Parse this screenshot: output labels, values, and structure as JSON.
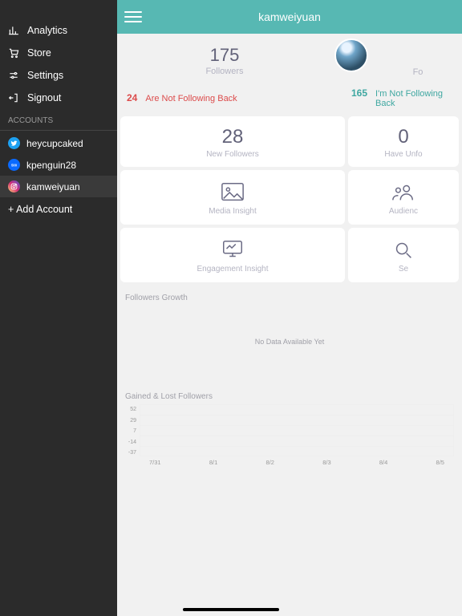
{
  "header": {
    "title": "kamweiyuan"
  },
  "sidebar": {
    "nav": [
      {
        "label": "Analytics"
      },
      {
        "label": "Store"
      },
      {
        "label": "Settings"
      },
      {
        "label": "Signout"
      }
    ],
    "section_label": "ACCOUNTS",
    "accounts": [
      {
        "label": "heycupcaked",
        "net": "twitter",
        "color": "#1DA1F2"
      },
      {
        "label": "kpenguin28",
        "net": "fivehundred",
        "color": "#0a6aff"
      },
      {
        "label": "kamweiyuan",
        "net": "instagram",
        "color": "#d63384"
      }
    ],
    "add_account": "+ Add Account"
  },
  "summary": {
    "followers_count": "175",
    "followers_label": "Followers",
    "following_label_partial": "Fo"
  },
  "warnings": {
    "left_count": "24",
    "left_label": "Are Not Following Back",
    "right_count": "165",
    "right_label": "I'm Not Following Back"
  },
  "cards": {
    "new_followers_count": "28",
    "new_followers_label": "New Followers",
    "right_top_count_partial": "0",
    "right_top_label_partial": "Have Unfo",
    "media_label": "Media Insight",
    "audience_label_partial": "Audienc",
    "engagement_label": "Engagement Insight",
    "search_label_partial": "Se"
  },
  "sections": {
    "growth_title": "Followers Growth",
    "growth_nodata": "No Data Available Yet",
    "gained_title": "Gained & Lost Followers"
  },
  "chart_data": {
    "type": "line",
    "categories": [
      "7/31",
      "8/1",
      "8/2",
      "8/3",
      "8/4",
      "8/5"
    ],
    "series": [],
    "ylabels": [
      "52",
      "29",
      "7",
      "-14",
      "-37"
    ],
    "ylim": [
      -37,
      52
    ],
    "title": "Gained & Lost Followers"
  }
}
